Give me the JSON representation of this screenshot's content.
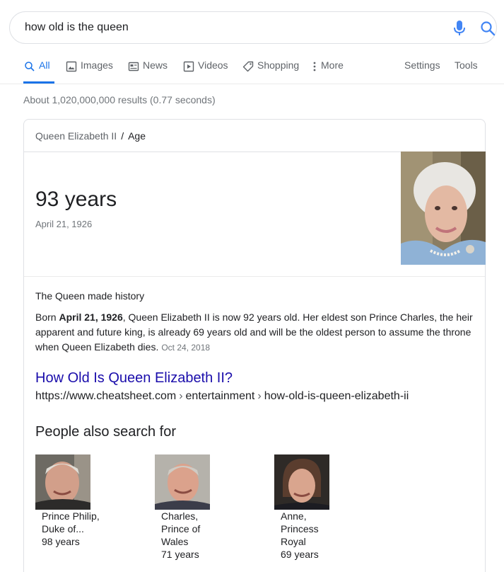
{
  "search": {
    "query": "how old is the queen"
  },
  "tabs": [
    {
      "label": "All",
      "icon": "search-icon"
    },
    {
      "label": "Images",
      "icon": "image-icon"
    },
    {
      "label": "News",
      "icon": "news-icon"
    },
    {
      "label": "Videos",
      "icon": "video-icon"
    },
    {
      "label": "Shopping",
      "icon": "tag-icon"
    },
    {
      "label": "More",
      "icon": "more-vert-icon"
    }
  ],
  "tools": {
    "settings": "Settings",
    "tools": "Tools"
  },
  "stats": "About 1,020,000,000 results (0.77 seconds)",
  "knowledge": {
    "entity": "Queen Elizabeth II",
    "separator": "/",
    "attribute": "Age",
    "answer": "93 years",
    "sub": "April 21, 1926"
  },
  "snippet": {
    "heading": "The Queen made history",
    "text_pre": "Born ",
    "text_bold": "April 21, 1926",
    "text_post": ", Queen Elizabeth II is now 92 years old. Her eldest son Prince Charles, the heir apparent and future king, is already 69 years old and will be the oldest person to assume the throne when Queen Elizabeth dies.",
    "date": "Oct 24, 2018"
  },
  "result": {
    "title": "How Old Is Queen Elizabeth II?",
    "url_domain": "https://www.cheatsheet.com",
    "url_path1": "entertainment",
    "url_path2": "how-old-is-queen-elizabeth-ii",
    "sep": "›"
  },
  "people_also_search": {
    "title": "People also search for",
    "people": [
      {
        "name_line1": "Prince Philip,",
        "name_line2": "Duke of...",
        "name_line3": "",
        "age": "98 years"
      },
      {
        "name_line1": "Charles,",
        "name_line2": "Prince of",
        "name_line3": "Wales",
        "age": "71 years"
      },
      {
        "name_line1": "Anne,",
        "name_line2": "Princess",
        "name_line3": "Royal",
        "age": "69 years"
      }
    ]
  },
  "colors": {
    "link": "#1a0dab",
    "accent": "#1a73e8",
    "muted": "#70757a"
  }
}
